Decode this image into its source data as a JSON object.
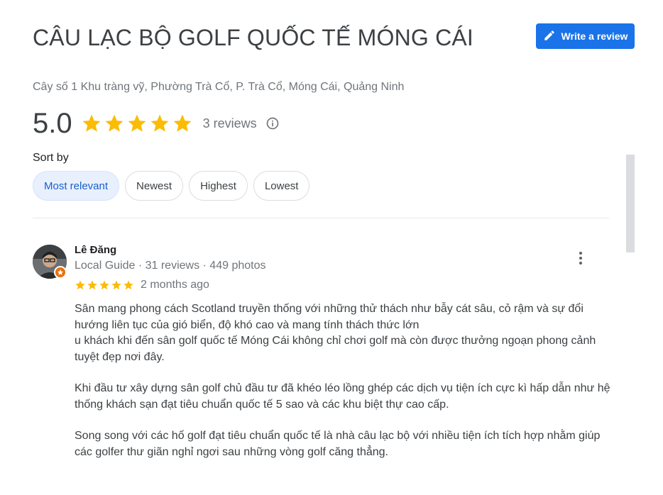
{
  "place": {
    "title": "CÂU LẠC BỘ GOLF QUỐC TẾ MÓNG CÁI",
    "address": "Cây số 1 Khu tràng vỹ, Phường Trà Cổ, P. Trà Cổ, Móng Cái, Quảng Ninh"
  },
  "actions": {
    "write_review_label": "Write a review"
  },
  "rating": {
    "score": "5.0",
    "stars": 5,
    "reviews_label": "3 reviews"
  },
  "sort": {
    "label": "Sort by",
    "options": [
      "Most relevant",
      "Newest",
      "Highest",
      "Lowest"
    ],
    "selected": "Most relevant"
  },
  "reviews": [
    {
      "name": "Lê Đăng",
      "guide_label": "Local Guide",
      "meta": " · 31 reviews · 449 photos",
      "stars": 5,
      "date": "2 months ago",
      "paragraphs": [
        "Sân mang phong cách Scotland truyền thống với những thử thách như bẫy cát sâu, cỏ rậm và sự đổi hướng liên tục của gió biển, độ khó cao và mang tính thách thức lớn",
        "u khách khi đến sân golf quốc tế Móng Cái không chỉ chơi golf mà còn được thưởng ngoạn phong cảnh tuyệt đẹp nơi đây.",
        "Khi đầu tư xây dựng sân golf chủ đầu tư đã khéo léo lồng ghép các dịch vụ tiện ích cực kì hấp dẫn như hệ thống khách sạn đạt tiêu chuẩn quốc tế 5 sao và các khu biệt thự cao cấp.",
        "Song song với các hố golf đạt tiêu chuẩn quốc tế là nhà câu lạc bộ với nhiều tiện ích tích hợp nhằm giúp các golfer thư giãn nghỉ ngơi sau những vòng golf căng thẳng."
      ]
    }
  ],
  "colors": {
    "star": "#fbbc04",
    "accent": "#1a73e8",
    "chip_active_bg": "#e8f0fe",
    "badge": "#e8710a"
  },
  "icons": [
    "edit-pencil-icon",
    "star-icon",
    "info-icon",
    "more-vert-icon",
    "local-guide-badge-icon"
  ]
}
